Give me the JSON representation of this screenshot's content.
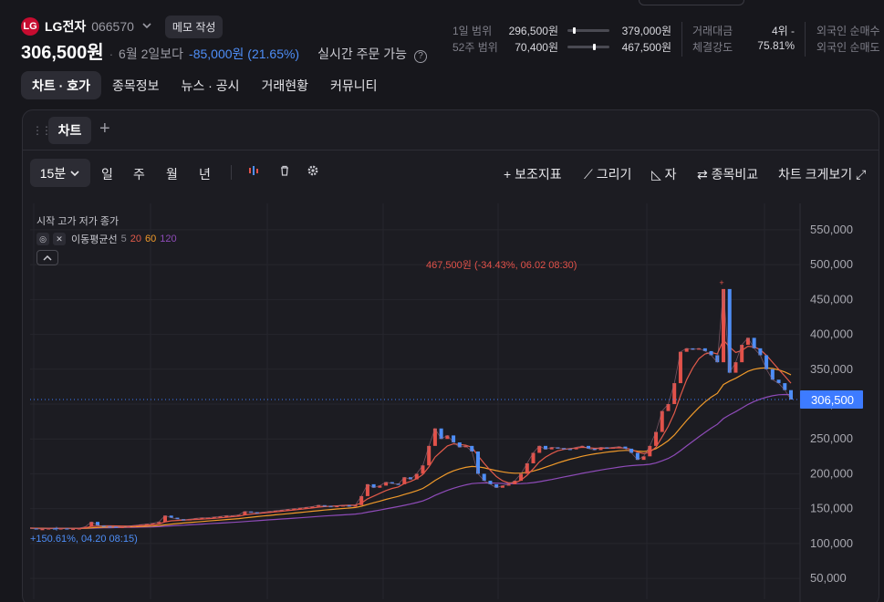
{
  "stock": {
    "logo_text": "LG",
    "name": "LG전자",
    "code": "066570",
    "memo_label": "메모 작성",
    "price": "306,500원",
    "compare_label": "6월 2일보다",
    "change": "-85,000원 (21.65%)",
    "realtime_label": "실시간 주문 가능",
    "help": "?"
  },
  "stats": {
    "day_range": {
      "label": "1일 범위",
      "low": "296,500원",
      "high": "379,000원",
      "marker": 0.12
    },
    "week52_range": {
      "label": "52주 범위",
      "low": "70,400원",
      "high": "467,500원",
      "marker": 0.6
    },
    "trade_amount": {
      "label": "거래대금",
      "value": "4위 -"
    },
    "strength": {
      "label": "체결강도",
      "value": "75.81%"
    },
    "foreign_buy": {
      "label": "외국인 순매수"
    },
    "foreign_sell": {
      "label": "외국인 순매도"
    }
  },
  "nav": {
    "tabs": [
      "차트 · 호가",
      "종목정보",
      "뉴스 · 공시",
      "거래현황",
      "커뮤니티"
    ]
  },
  "panel": {
    "tab_label": "차트",
    "add": "+"
  },
  "toolbar": {
    "timeframe": "15분",
    "periods": [
      "일",
      "주",
      "월",
      "년"
    ],
    "indicator": "+ 보조지표",
    "draw": "그리기",
    "ruler": "자",
    "compare": "종목비교",
    "enlarge": "차트 크게보기"
  },
  "legend": {
    "ohlc": "시작 고가 저가 종가",
    "ma_name": "이동평균선",
    "ma": [
      {
        "period": "5",
        "color": "#8a8a92"
      },
      {
        "period": "20",
        "color": "#e25a4a"
      },
      {
        "period": "60",
        "color": "#f09a2a"
      },
      {
        "period": "120",
        "color": "#8e4bb8"
      }
    ]
  },
  "colors": {
    "up": "#e2524a",
    "down": "#4e8ef7",
    "accent": "#3d7bff"
  },
  "chart_data": {
    "type": "line",
    "ylim": [
      20000,
      580000
    ],
    "y_ticks": [
      "550,000",
      "500,000",
      "450,000",
      "400,000",
      "350,000",
      "300,000",
      "250,000",
      "200,000",
      "150,000",
      "100,000",
      "50,000"
    ],
    "y_tick_values": [
      550000,
      500000,
      450000,
      400000,
      350000,
      300000,
      250000,
      200000,
      150000,
      100000,
      50000
    ],
    "current_price_label": "306,500",
    "current_price": 306500,
    "high_annotation": "467,500원 (-34.43%, 06.02 08:30)",
    "low_annotation": "+150.61%, 04.20 08:15)",
    "series": [
      {
        "name": "5",
        "values": [
          122000,
          121000,
          121000,
          122000,
          121000,
          122000,
          121000,
          121500,
          122000,
          124000,
          131000,
          126000,
          125000,
          124500,
          124000,
          124000,
          125000,
          126000,
          127000,
          128000,
          129000,
          131000,
          140000,
          137000,
          135000,
          134000,
          135000,
          136000,
          137000,
          137000,
          138000,
          139000,
          140000,
          140000,
          141000,
          146000,
          145000,
          144000,
          145000,
          146000,
          147000,
          148000,
          149000,
          150000,
          151000,
          152000,
          153000,
          155000,
          154000,
          153000,
          154000,
          155000,
          153000,
          155000,
          168000,
          185000,
          180000,
          183000,
          188000,
          186000,
          185000,
          195000,
          192000,
          200000,
          212000,
          240000,
          265000,
          250000,
          255000,
          245000,
          238000,
          240000,
          232000,
          200000,
          190000,
          185000,
          180000,
          183000,
          185000,
          190000,
          200000,
          215000,
          230000,
          240000,
          235000,
          238000,
          237000,
          236000,
          235000,
          238000,
          240000,
          236000,
          234000,
          238000,
          237000,
          238000,
          239000,
          236000,
          230000,
          220000,
          225000,
          240000,
          260000,
          290000,
          300000,
          330000,
          375000,
          380000,
          378000,
          380000,
          376000,
          370000,
          360000,
          465000,
          345000,
          360000,
          385000,
          395000,
          380000,
          370000,
          350000,
          335000,
          330000,
          320000,
          306500
        ]
      },
      {
        "name": "20",
        "values": [
          122000,
          121800,
          121500,
          121500,
          121500,
          121700,
          121600,
          121700,
          121900,
          122400,
          124500,
          125000,
          125300,
          125300,
          125200,
          125100,
          125100,
          125300,
          125700,
          126200,
          127000,
          128000,
          131000,
          132500,
          133000,
          133500,
          134000,
          134500,
          135000,
          135500,
          136000,
          136800,
          137600,
          138500,
          139200,
          141000,
          142200,
          143000,
          143800,
          144600,
          145500,
          146300,
          147200,
          148100,
          149000,
          150000,
          151000,
          152200,
          153000,
          153400,
          154000,
          154600,
          155000,
          155200,
          158000,
          164000,
          168000,
          172000,
          176000,
          179000,
          181000,
          186000,
          189000,
          193000,
          199000,
          210000,
          224000,
          232000,
          240000,
          243000,
          242000,
          241000,
          238000,
          226000,
          215000,
          205000,
          196000,
          190000,
          187000,
          187000,
          191000,
          198000,
          207000,
          217000,
          224000,
          229000,
          233000,
          235000,
          236000,
          237000,
          238000,
          237500,
          236500,
          236800,
          236700,
          237000,
          237300,
          236800,
          235000,
          231000,
          229000,
          231000,
          238000,
          253000,
          268000,
          287000,
          312000,
          335000,
          352000,
          365000,
          372000,
          374000,
          372000,
          392000,
          382000,
          374000,
          377000,
          383000,
          382000,
          378000,
          370000,
          360000,
          350000,
          340000,
          330000
        ]
      },
      {
        "name": "60",
        "values": [
          122000,
          121900,
          121800,
          121700,
          121600,
          121600,
          121600,
          121600,
          121700,
          121900,
          122500,
          123000,
          123300,
          123500,
          123600,
          123700,
          123800,
          124000,
          124300,
          124700,
          125100,
          125700,
          126800,
          127800,
          128600,
          129400,
          130100,
          130800,
          131500,
          132200,
          132900,
          133600,
          134300,
          135000,
          135700,
          136700,
          137600,
          138500,
          139400,
          140200,
          141100,
          141900,
          142700,
          143600,
          144400,
          145300,
          146200,
          147100,
          148000,
          148700,
          149500,
          150200,
          150900,
          151600,
          153400,
          156000,
          158400,
          160800,
          163300,
          165500,
          167600,
          170300,
          172800,
          175600,
          179000,
          184300,
          190500,
          195500,
          200400,
          204200,
          207000,
          209200,
          210500,
          210000,
          208500,
          206500,
          204500,
          202800,
          201500,
          200800,
          201000,
          202000,
          204000,
          206500,
          209500,
          212500,
          215500,
          218200,
          220800,
          223000,
          225200,
          227000,
          228500,
          229800,
          231000,
          232000,
          233000,
          233500,
          233500,
          232500,
          232000,
          233000,
          236000,
          241500,
          247500,
          255500,
          266000,
          276500,
          286000,
          295000,
          303000,
          310000,
          315500,
          328000,
          333000,
          337000,
          342000,
          347000,
          350000,
          351500,
          352000,
          351000,
          349000,
          346000,
          342000
        ]
      },
      {
        "name": "120",
        "values": [
          122000,
          121950,
          121900,
          121850,
          121800,
          121750,
          121720,
          121700,
          121700,
          121750,
          121950,
          122200,
          122400,
          122600,
          122800,
          122950,
          123100,
          123250,
          123450,
          123650,
          123900,
          124200,
          124750,
          125300,
          125800,
          126300,
          126800,
          127300,
          127800,
          128300,
          128800,
          129300,
          129800,
          130300,
          130850,
          131500,
          132100,
          132700,
          133300,
          133900,
          134500,
          135100,
          135700,
          136300,
          136900,
          137500,
          138100,
          138750,
          139400,
          139950,
          140500,
          141050,
          141600,
          142150,
          143250,
          144950,
          146450,
          148000,
          149700,
          151350,
          152900,
          154800,
          156650,
          158700,
          161000,
          164700,
          169000,
          172650,
          176200,
          179200,
          181800,
          184100,
          185900,
          186600,
          186900,
          186800,
          186500,
          186200,
          186000,
          185800,
          185900,
          186400,
          187300,
          188700,
          190200,
          191800,
          193600,
          195400,
          197200,
          198900,
          200700,
          202300,
          203800,
          205400,
          206800,
          208200,
          209600,
          210800,
          211700,
          212300,
          212800,
          213700,
          215500,
          218600,
          222000,
          226800,
          233200,
          239900,
          246500,
          253000,
          259300,
          265400,
          270900,
          279200,
          284400,
          289200,
          294300,
          299500,
          303600,
          307000,
          309800,
          311900,
          313300,
          313700,
          313600
        ]
      }
    ]
  }
}
